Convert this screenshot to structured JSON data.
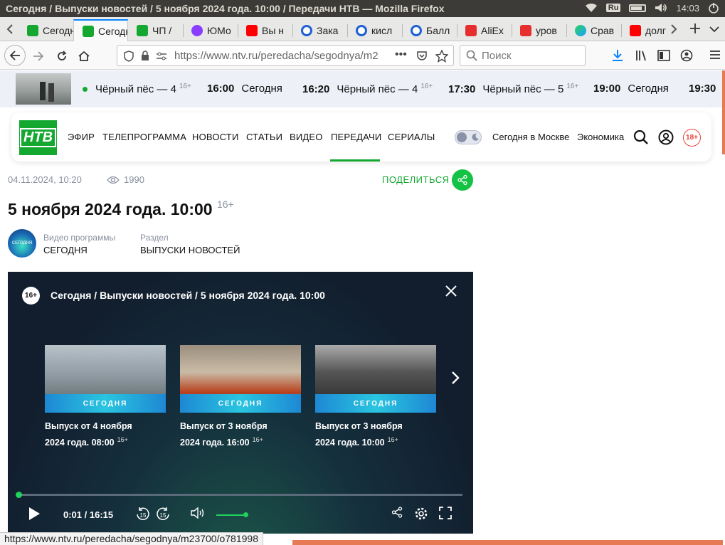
{
  "os": {
    "window_title": "Сегодня / Выпуски новостей / 5 ноября 2024 года. 10:00 / Передачи НТВ — Mozilla Firefox",
    "lang": "Ru",
    "clock": "14:03"
  },
  "tabs": [
    {
      "label": "Сегодня",
      "favicon": "ntv"
    },
    {
      "label": "Сегодня",
      "favicon": "ntv",
      "active": true
    },
    {
      "label": "ЧП /",
      "favicon": "ntv"
    },
    {
      "label": "ЮМо",
      "favicon": "yum"
    },
    {
      "label": "Вы н",
      "favicon": "yt"
    },
    {
      "label": "Зака",
      "favicon": "ok"
    },
    {
      "label": "кисл",
      "favicon": "ok"
    },
    {
      "label": "Балл",
      "favicon": "ok"
    },
    {
      "label": "AliEx",
      "favicon": "ali"
    },
    {
      "label": "уров",
      "favicon": "ali"
    },
    {
      "label": "Срав",
      "favicon": "srav"
    },
    {
      "label": "долг",
      "favicon": "yt"
    }
  ],
  "navbar": {
    "url": "https://www.ntv.ru/peredacha/segodnya/m2",
    "search_placeholder": "Поиск"
  },
  "schedule": {
    "items": [
      {
        "time": "",
        "title": "Чёрный пёс — 4",
        "age": "16+"
      },
      {
        "time": "16:00",
        "title": "Сегодня",
        "age": ""
      },
      {
        "time": "16:20",
        "title": "Чёрный пёс — 4",
        "age": "16+"
      },
      {
        "time": "17:30",
        "title": "Чёрный пёс — 5",
        "age": "16+"
      },
      {
        "time": "19:00",
        "title": "Сегодня",
        "age": ""
      },
      {
        "time": "19:30",
        "title": "",
        "age": ""
      }
    ]
  },
  "header": {
    "logo_text": "НТВ",
    "menu": [
      "ЭФИР",
      "ТЕЛЕПРОГРАММА",
      "НОВОСТИ",
      "СТАТЬИ",
      "ВИДЕО",
      "ПЕРЕДАЧИ",
      "СЕРИАЛЫ"
    ],
    "active_menu": "ПЕРЕДАЧИ",
    "link_moscow": "Сегодня в Москве",
    "link_economy": "Экономика",
    "age_badge": "18+"
  },
  "article": {
    "date": "04.11.2024, 10:20",
    "views": "1990",
    "share_label": "ПОДЕЛИТЬСЯ",
    "title": "5 ноября 2024 года. 10:00",
    "title_age": "16+",
    "program_label": "Видео программы",
    "program_value": "СЕГОДНЯ",
    "section_label": "Раздел",
    "section_value": "ВЫПУСКИ НОВОСТЕЙ"
  },
  "player": {
    "age": "16+",
    "title": "Сегодня / Выпуски новостей / 5 ноября 2024 года. 10:00",
    "cards": [
      {
        "line1": "Выпуск от 4 ноября",
        "line2": "2024 года. 08:00",
        "age": "16+",
        "band": "СЕГОДНЯ"
      },
      {
        "line1": "Выпуск от 3 ноября",
        "line2": "2024 года. 16:00",
        "age": "16+",
        "band": "СЕГОДНЯ"
      },
      {
        "line1": "Выпуск от 3 ноября",
        "line2": "2024 года. 10:00",
        "age": "16+",
        "band": "СЕГОДНЯ"
      }
    ],
    "time_current": "0:01",
    "time_total": "16:15",
    "progress_fraction": 0.001,
    "volume_fraction": 1.0,
    "accent_color": "#20d35a"
  },
  "status_url": "https://www.ntv.ru/peredacha/segodnya/m23700/o781998"
}
